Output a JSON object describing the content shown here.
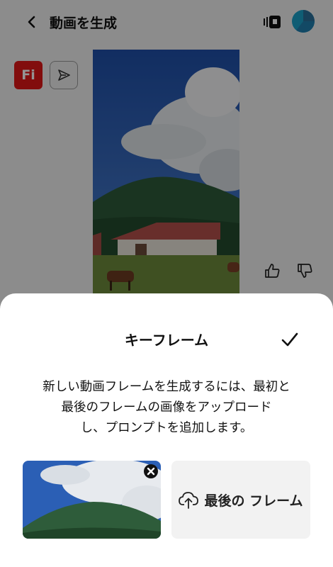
{
  "header": {
    "title": "動画を生成",
    "back_icon": "chevron-left-icon",
    "media_icon": "film-stack-icon",
    "avatar_color": "#1aa0c8"
  },
  "canvas": {
    "badge_label": "Fi",
    "badge_color": "#e01818",
    "send_icon": "send-icon",
    "feedback": [
      "thumbs-up-icon",
      "thumbs-down-icon"
    ]
  },
  "sheet": {
    "title": "キーフレーム",
    "confirm_icon": "checkmark-icon",
    "description_lines": [
      "新しい動画フレームを生成するには、最初と",
      "最後のフレームの画像をアップロード",
      "し、プロンプトを追加します。"
    ],
    "first_frame": {
      "remove_icon": "close-circle-icon"
    },
    "last_frame": {
      "label": "最後の フレーム",
      "icon": "cloud-upload-icon"
    }
  }
}
